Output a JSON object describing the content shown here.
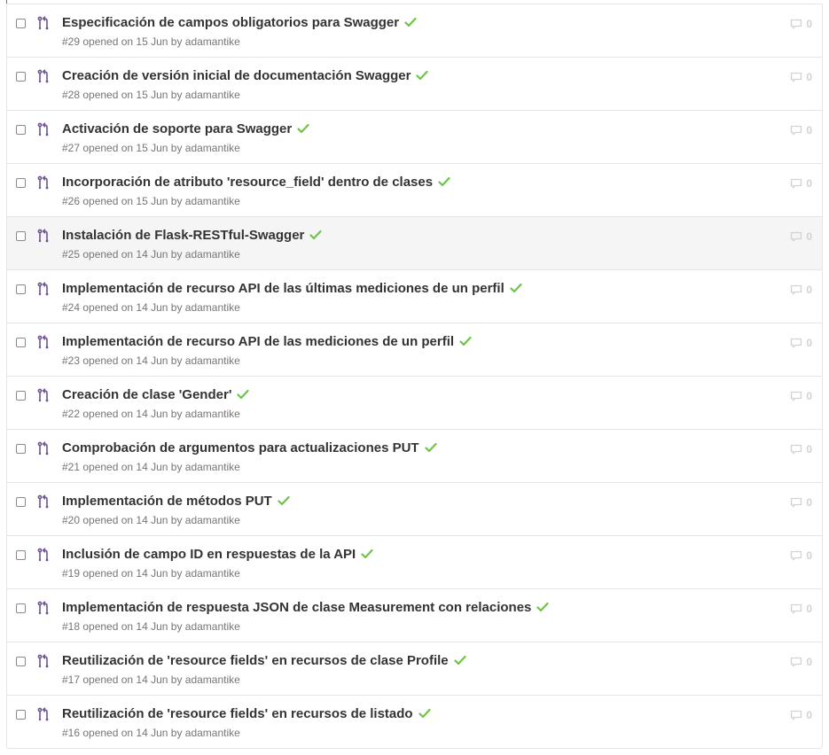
{
  "colors": {
    "pr_icon": "#6e5494",
    "check": "#6cc644",
    "meta": "#767676",
    "title": "#333333"
  },
  "icons": {
    "row_icon": "git-pull-request-icon",
    "status": "check-icon",
    "comments": "comment-icon"
  },
  "rows": [
    {
      "title": "Especificación de campos obligatorios para Swagger",
      "meta": "#29 opened on 15 Jun by adamantike",
      "comments": "0"
    },
    {
      "title": "Creación de versión inicial de documentación Swagger",
      "meta": "#28 opened on 15 Jun by adamantike",
      "comments": "0"
    },
    {
      "title": "Activación de soporte para Swagger",
      "meta": "#27 opened on 15 Jun by adamantike",
      "comments": "0"
    },
    {
      "title": "Incorporación de atributo 'resource_field' dentro de clases",
      "meta": "#26 opened on 15 Jun by adamantike",
      "comments": "0"
    },
    {
      "title": "Instalación de Flask-RESTful-Swagger",
      "meta": "#25 opened on 14 Jun by adamantike",
      "comments": "0"
    },
    {
      "title": "Implementación de recurso API de las últimas mediciones de un perfil",
      "meta": "#24 opened on 14 Jun by adamantike",
      "comments": "0"
    },
    {
      "title": "Implementación de recurso API de las mediciones de un perfil",
      "meta": "#23 opened on 14 Jun by adamantike",
      "comments": "0"
    },
    {
      "title": "Creación de clase 'Gender'",
      "meta": "#22 opened on 14 Jun by adamantike",
      "comments": "0"
    },
    {
      "title": "Comprobación de argumentos para actualizaciones PUT",
      "meta": "#21 opened on 14 Jun by adamantike",
      "comments": "0"
    },
    {
      "title": "Implementación de métodos PUT",
      "meta": "#20 opened on 14 Jun by adamantike",
      "comments": "0"
    },
    {
      "title": "Inclusión de campo ID en respuestas de la API",
      "meta": "#19 opened on 14 Jun by adamantike",
      "comments": "0"
    },
    {
      "title": "Implementación de respuesta JSON de clase Measurement con relaciones",
      "meta": "#18 opened on 14 Jun by adamantike",
      "comments": "0"
    },
    {
      "title": "Reutilización de 'resource fields' en recursos de clase Profile",
      "meta": "#17 opened on 14 Jun by adamantike",
      "comments": "0"
    },
    {
      "title": "Reutilización de 'resource fields' en recursos de listado",
      "meta": "#16 opened on 14 Jun by adamantike",
      "comments": "0"
    }
  ]
}
